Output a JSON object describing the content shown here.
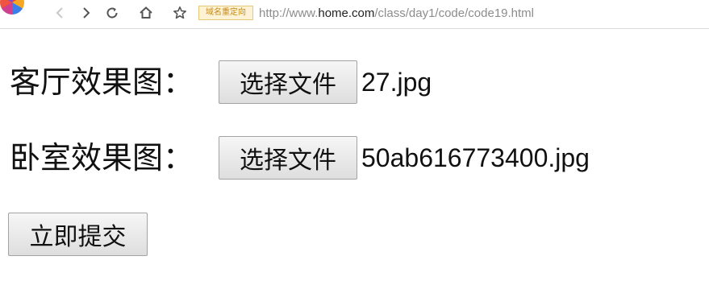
{
  "browser": {
    "icons": [
      "browser-logo",
      "back-icon",
      "forward-icon",
      "reload-icon",
      "home-icon",
      "bookmark-star-icon"
    ],
    "redirect_badge": "域名重定向",
    "url": {
      "scheme": "http://www.",
      "host": "home.com",
      "path": "/class/day1/code/code19.html"
    },
    "colors": {
      "badge_bg": "#fdf3d4",
      "badge_text": "#c58a1a",
      "url_gray": "#8c8c8c"
    }
  },
  "form": {
    "rows": [
      {
        "label": "客厅效果图：",
        "button": "选择文件",
        "file": "27.jpg"
      },
      {
        "label": "卧室效果图：",
        "button": "选择文件",
        "file": "50ab616773400.jpg"
      }
    ],
    "submit": "立即提交"
  }
}
